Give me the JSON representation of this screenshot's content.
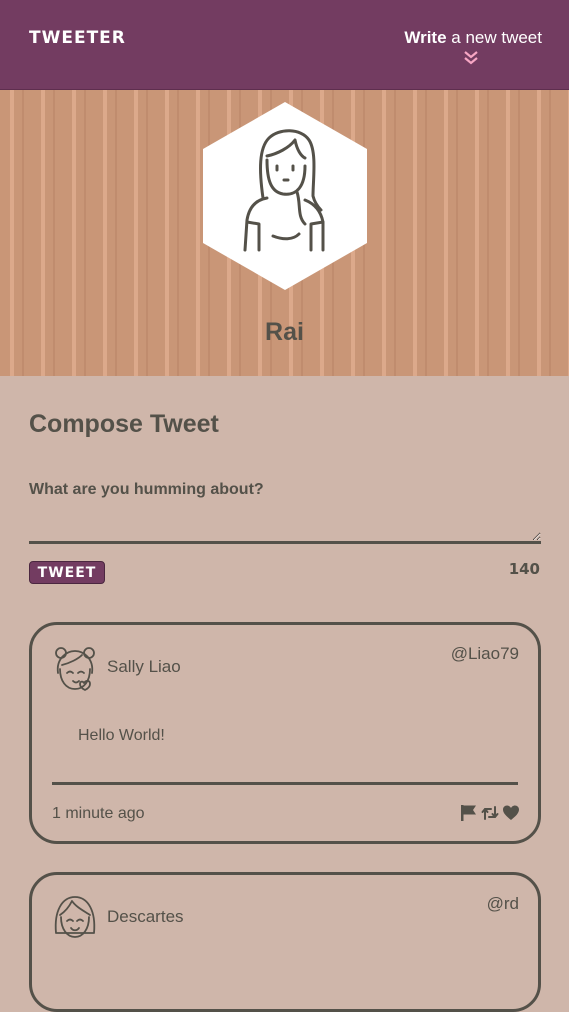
{
  "nav": {
    "brand": "TWEETER",
    "write_bold": "Write",
    "write_rest": " a new tweet",
    "chevron_icon": "double-chevron-down-icon",
    "chevron_color": "#f7a6c4"
  },
  "profile": {
    "name": "Rai",
    "avatar_icon": "girl-avatar-icon"
  },
  "compose": {
    "title": "Compose Tweet",
    "label": "What are you humming about?",
    "value": "",
    "button_label": "TWEET",
    "counter": "140"
  },
  "tweets": [
    {
      "name": "Sally Liao",
      "handle": "@Liao79",
      "text": "Hello World!",
      "time": "1 minute ago",
      "avatar_icon": "girl-buns-avatar-icon",
      "actions": [
        "flag-icon",
        "retweet-icon",
        "heart-icon"
      ]
    },
    {
      "name": "Descartes",
      "handle": "@rd",
      "avatar_icon": "girl-bob-avatar-icon"
    }
  ],
  "colors": {
    "nav": "#733c61",
    "page": "#cfb6aa",
    "text": "#545149",
    "hero": "#c99677"
  }
}
